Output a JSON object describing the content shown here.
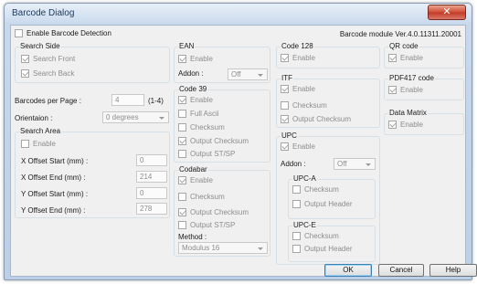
{
  "window": {
    "title": "Barcode Dialog",
    "close_label": "✕"
  },
  "top": {
    "enable_detection": "Enable Barcode Detection",
    "module_version": "Barcode module Ver.4.0.11311.20001"
  },
  "search_side": {
    "title": "Search Side",
    "front": "Search Front",
    "back": "Search Back"
  },
  "barcodes_per_page": {
    "label": "Barcodes per Page :",
    "value": "4",
    "range": "(1-4)"
  },
  "orientation": {
    "label": "Orientaion :",
    "value": "0 degrees"
  },
  "search_area": {
    "title": "Search Area",
    "enable": "Enable",
    "x_start_label": "X Offset Start (mm) :",
    "x_start": "0",
    "x_end_label": "X Offset End (mm) :",
    "x_end": "214",
    "y_start_label": "Y Offset Start (mm) :",
    "y_start": "0",
    "y_end_label": "Y Offset End (mm) :",
    "y_end": "278"
  },
  "ean": {
    "title": "EAN",
    "enable": "Enable",
    "addon_label": "Addon :",
    "addon_value": "Off"
  },
  "code39": {
    "title": "Code 39",
    "enable": "Enable",
    "full_ascii": "Full Ascii",
    "checksum": "Checksum",
    "output_checksum": "Output Checksum",
    "output_st_sp": "Output ST/SP"
  },
  "codabar": {
    "title": "Codabar",
    "enable": "Enable",
    "checksum": "Checksum",
    "output_checksum": "Output Checksum",
    "output_st_sp": "Output ST/SP",
    "method_label": "Method :",
    "method_value": "Modulus 16"
  },
  "code128": {
    "title": "Code 128",
    "enable": "Enable"
  },
  "itf": {
    "title": "ITF",
    "enable": "Enable",
    "checksum": "Checksum",
    "output_checksum": "Output Checksum"
  },
  "upc": {
    "title": "UPC",
    "enable": "Enable",
    "addon_label": "Addon :",
    "addon_value": "Off",
    "upca_title": "UPC-A",
    "upca_checksum": "Checksum",
    "upca_output_header": "Output Header",
    "upce_title": "UPC-E",
    "upce_checksum": "Checksum",
    "upce_output_header": "Output Header"
  },
  "qr": {
    "title": "QR code",
    "enable": "Enable"
  },
  "pdf417": {
    "title": "PDF417 code",
    "enable": "Enable"
  },
  "datamatrix": {
    "title": "Data Matrix",
    "enable": "Enable"
  },
  "buttons": {
    "ok": "OK",
    "cancel": "Cancel",
    "help": "Help"
  }
}
